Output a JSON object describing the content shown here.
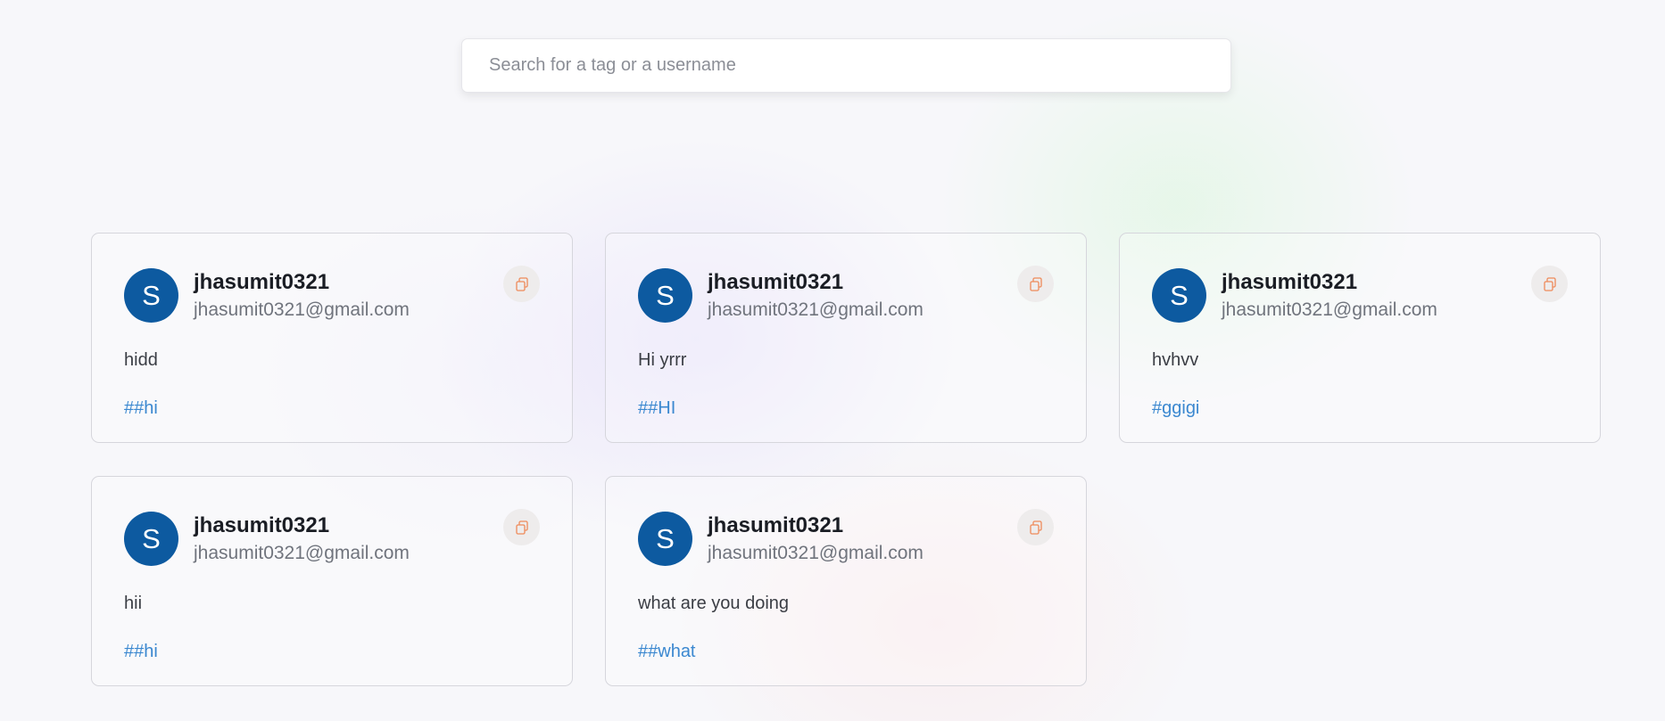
{
  "search": {
    "placeholder": "Search for a tag or a username",
    "value": ""
  },
  "colors": {
    "avatar_bg": "#0d5aa0",
    "tag": "#3b88d0",
    "copy_icon": "#ef8a5a"
  },
  "posts": [
    {
      "avatar_letter": "S",
      "username": "jhasumit0321",
      "email": "jhasumit0321@gmail.com",
      "prompt": "hidd",
      "tag": "##hi",
      "copy_icon": "copy-icon"
    },
    {
      "avatar_letter": "S",
      "username": "jhasumit0321",
      "email": "jhasumit0321@gmail.com",
      "prompt": "Hi yrrr",
      "tag": "##HI",
      "copy_icon": "copy-icon"
    },
    {
      "avatar_letter": "S",
      "username": "jhasumit0321",
      "email": "jhasumit0321@gmail.com",
      "prompt": "hvhvv",
      "tag": "#ggigi",
      "copy_icon": "copy-icon"
    },
    {
      "avatar_letter": "S",
      "username": "jhasumit0321",
      "email": "jhasumit0321@gmail.com",
      "prompt": "hii",
      "tag": "##hi",
      "copy_icon": "copy-icon"
    },
    {
      "avatar_letter": "S",
      "username": "jhasumit0321",
      "email": "jhasumit0321@gmail.com",
      "prompt": "what are you doing",
      "tag": "##what",
      "copy_icon": "copy-icon"
    }
  ]
}
